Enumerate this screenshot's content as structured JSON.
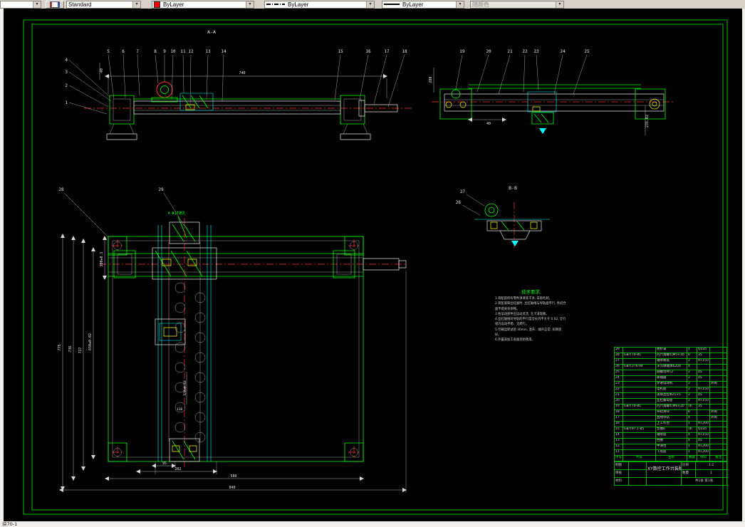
{
  "toolbar": {
    "style_combo": {
      "value": "Standard"
    },
    "color_combo": {
      "value": "ByLayer",
      "swatch_color": "#ff0000"
    },
    "linetype_combo": {
      "value": "ByLayer"
    },
    "lineweight_combo": {
      "value": "ByLayer"
    },
    "plotstyle_combo": {
      "value": "随颜色"
    }
  },
  "statusbar": {
    "doc_label": "块70-1"
  },
  "drawing": {
    "section_aa": {
      "label": "A-A",
      "dim_740": "740",
      "dim_40": "40",
      "callouts_left": [
        "4",
        "3",
        "2",
        "1"
      ],
      "callouts_top": [
        "5",
        "6",
        "7",
        "8",
        "9",
        "10",
        "11",
        "12",
        "13",
        "14"
      ],
      "callouts_right": [
        "15",
        "16",
        "17",
        "18"
      ]
    },
    "side_view": {
      "callouts": [
        "19",
        "20",
        "21",
        "22",
        "23",
        "24",
        "25"
      ],
      "dim_40": "40",
      "dim_280": "280",
      "dim_231": "231.02"
    },
    "section_bb": {
      "label": "B-B",
      "callouts": [
        "27",
        "26"
      ]
    },
    "plan_view": {
      "callouts": [
        "28",
        "29"
      ],
      "hole_note": "4-Φ17通孔",
      "dim_775": "775",
      "dim_736": "736",
      "dim_717": "717",
      "dim_650": "650±0.02",
      "dim_300": "300±0.1",
      "dim_120": "120±0.02",
      "dim_110": "110",
      "dim_95": "95",
      "dim_262": "262",
      "dim_580": "580",
      "dim_840": "840"
    },
    "tech_notes": {
      "title": "技术要求",
      "lines": [
        "1.装配前所有零件须清洗干净, 去除毛刺。",
        "2.装配滚珠丝杠副时, 丝杠轴线与导轨面平行, 各结合面不得夹有杂物。",
        "3.各运动部件应运动灵活, 无卡滞现象。",
        "4.丝杠轴线对导轨的平行度全长内不大于 0.02, 全行程内运动平稳、无爬行。",
        "5.空载运转试验 30min, 温升、噪声正常, 润滑良好。",
        "6.外露非加工表面涂防锈漆。"
      ]
    },
    "bom": {
      "headers": [
        "序号",
        "代号",
        "名称",
        "数量",
        "材料",
        "备注"
      ],
      "rows": [
        [
          "29",
          "",
          "防护罩",
          "1",
          "Q235",
          ""
        ],
        [
          "28",
          "GB/T70-85",
          "内六角螺钉M5×16",
          "8",
          "35",
          ""
        ],
        [
          "27",
          "",
          "轴承端盖",
          "2",
          "HT150",
          ""
        ],
        [
          "26",
          "GB/T276-94",
          "深沟球轴承6204",
          "4",
          "",
          ""
        ],
        [
          "25",
          "",
          "圆螺母M12",
          "2",
          "45",
          ""
        ],
        [
          "24",
          "",
          "联轴器",
          "2",
          "45",
          ""
        ],
        [
          "23",
          "",
          "步进电动机",
          "2",
          "",
          "外购"
        ],
        [
          "22",
          "",
          "电机座",
          "2",
          "HT150",
          ""
        ],
        [
          "21",
          "",
          "滚珠丝杠Φ25×5",
          "2",
          "45",
          ""
        ],
        [
          "20",
          "",
          "丝杠螺母座",
          "2",
          "HT150",
          ""
        ],
        [
          "19",
          "GB/T70-85",
          "内六角螺钉M6×20",
          "16",
          "35",
          ""
        ],
        [
          "18",
          "",
          "导轨滑块",
          "8",
          "",
          "外购"
        ],
        [
          "17",
          "",
          "直线导轨",
          "4",
          "",
          "外购"
        ],
        [
          "16",
          "",
          "上工作台",
          "1",
          "HT200",
          ""
        ],
        [
          "15",
          "GB/T97.1-85",
          "垫圈6",
          "16",
          "Q235",
          ""
        ],
        [
          "14",
          "",
          "轴承座",
          "4",
          "HT150",
          ""
        ],
        [
          "13",
          "",
          "挡圈",
          "4",
          "45",
          ""
        ],
        [
          "12",
          "",
          "中滑台",
          "1",
          "HT200",
          ""
        ],
        [
          "11",
          "",
          "下底座",
          "1",
          "HT200",
          ""
        ]
      ]
    },
    "title_block": {
      "title": "XY数控工作台装配图",
      "drawn_label": "制图",
      "checked_label": "审核",
      "material_label": "材料",
      "scale_label": "比例",
      "scale_value": "1:2",
      "qty_label": "数量",
      "qty_value": "1",
      "sheet_info": "共1张 第1张"
    }
  }
}
